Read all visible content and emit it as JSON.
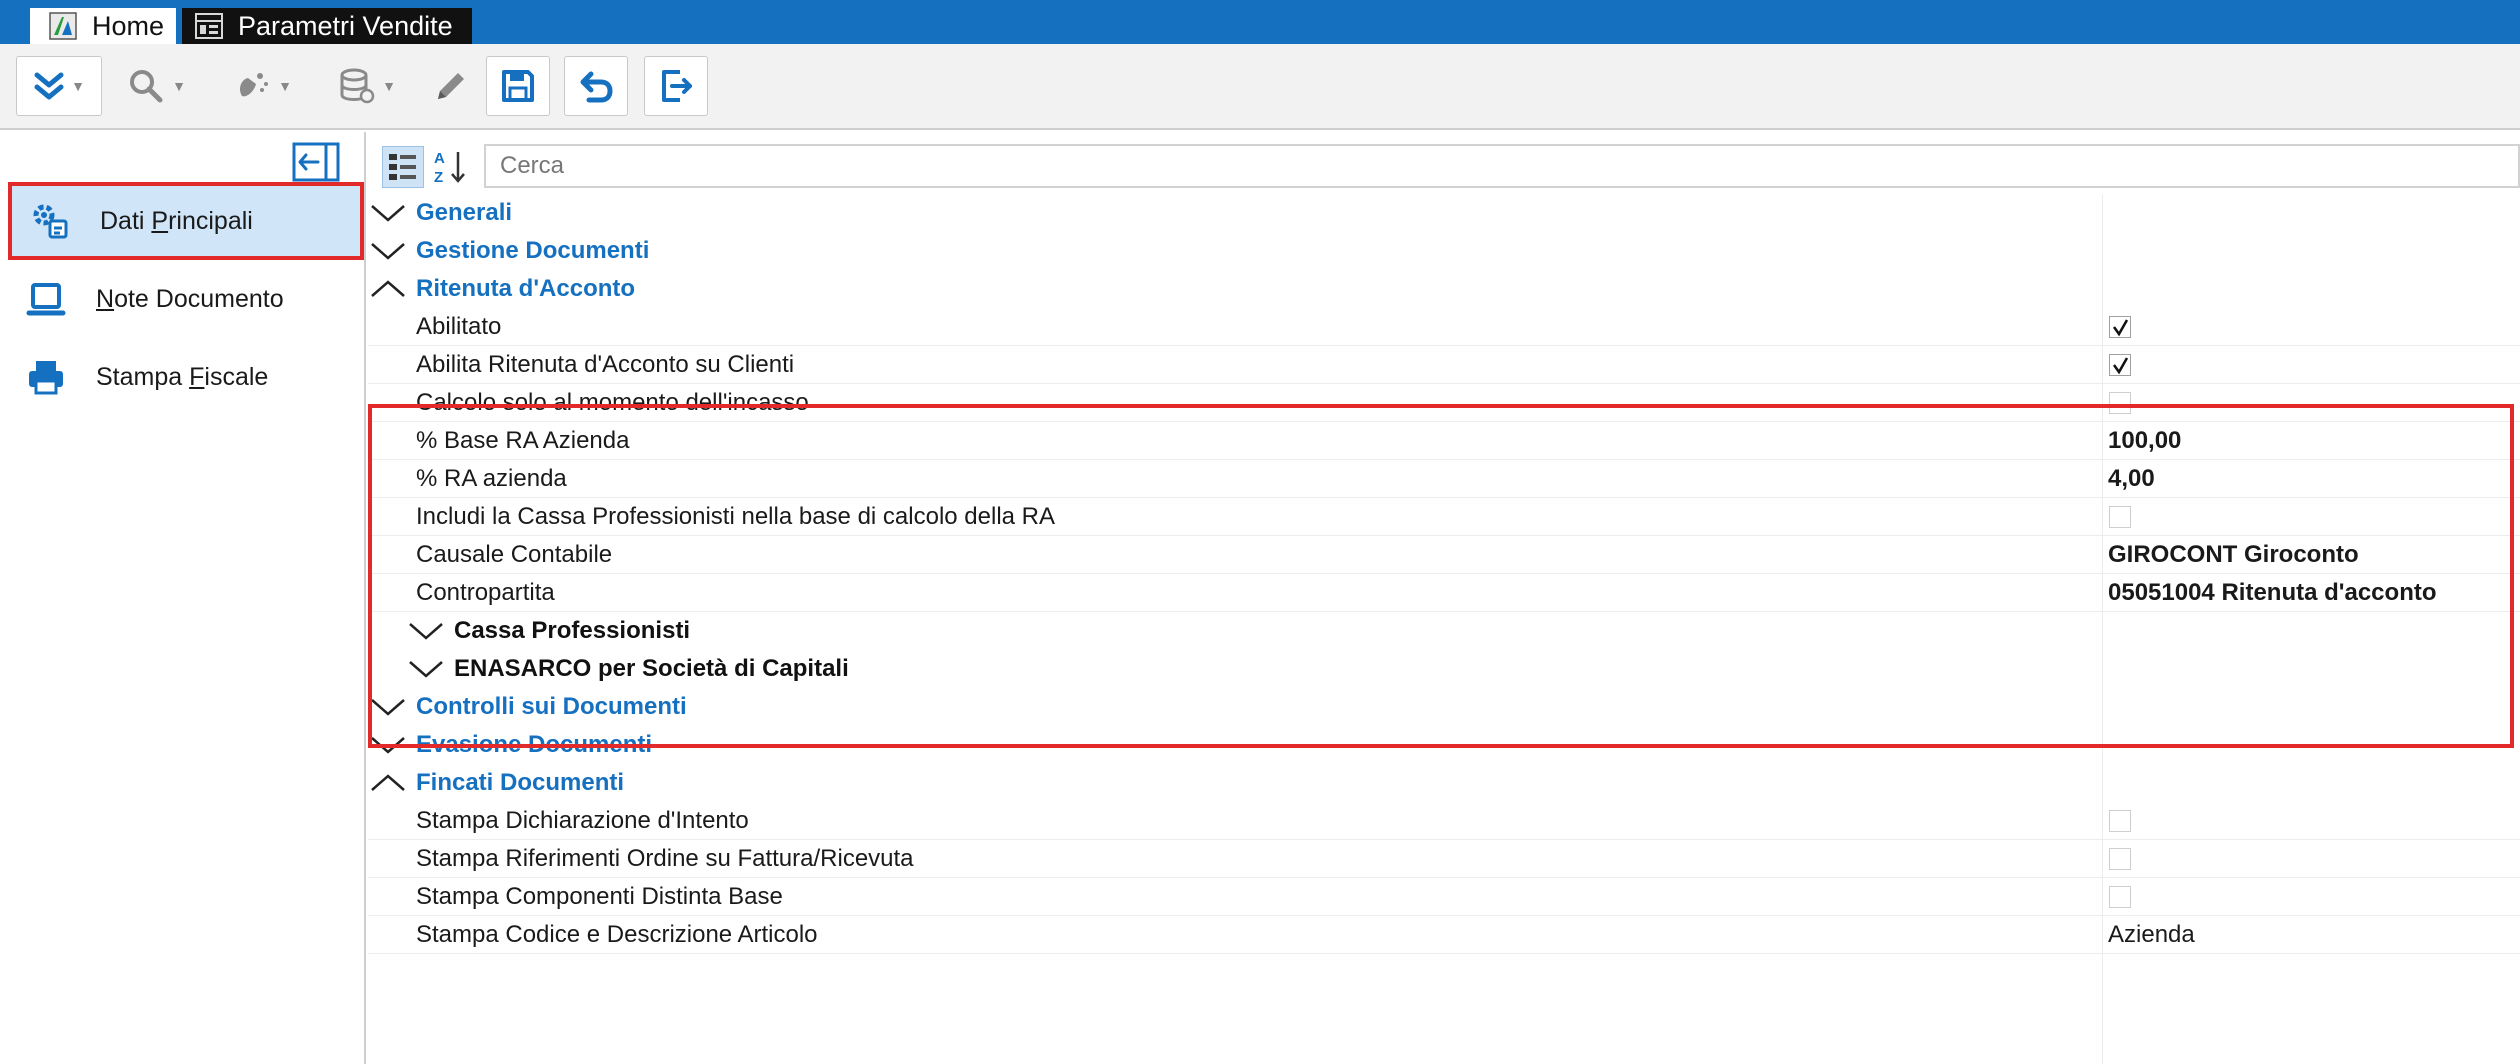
{
  "tabs": [
    {
      "label": "Home",
      "icon": "app-logo-icon"
    },
    {
      "label": "Parametri Vendite",
      "icon": "table-window-icon"
    }
  ],
  "toolbar": {
    "buttons": [
      {
        "name": "expand-menu-button",
        "icon": "double-chevron-down-icon"
      },
      {
        "name": "search-button",
        "icon": "magnifier-icon"
      },
      {
        "name": "wizard-button",
        "icon": "magic-wand-icon"
      },
      {
        "name": "database-button",
        "icon": "database-icon"
      },
      {
        "name": "edit-button",
        "icon": "pencil-icon"
      },
      {
        "name": "save-button",
        "icon": "floppy-disk-icon"
      },
      {
        "name": "undo-button",
        "icon": "undo-arrow-icon"
      },
      {
        "name": "exit-button",
        "icon": "exit-icon"
      }
    ],
    "accent_color": "#1570c0"
  },
  "sidebar": {
    "items": [
      {
        "label_pre": "Dati ",
        "label_ul": "P",
        "label_post": "rincipali",
        "icon": "settings-gear-icon",
        "selected": true
      },
      {
        "label_pre": "",
        "label_ul": "N",
        "label_post": "ote Documento",
        "icon": "laptop-icon",
        "selected": false
      },
      {
        "label_pre": "Stampa ",
        "label_ul": "F",
        "label_post": "iscale",
        "icon": "printer-icon",
        "selected": false
      }
    ]
  },
  "search": {
    "placeholder": "Cerca",
    "value": ""
  },
  "grid": {
    "categories": {
      "generali": {
        "label": "Generali",
        "expanded": false
      },
      "gestione_documenti": {
        "label": "Gestione Documenti",
        "expanded": false
      },
      "ritenuta": {
        "label": "Ritenuta d'Acconto",
        "expanded": true,
        "props": [
          {
            "label": "Abilitato",
            "type": "checkbox",
            "checked": true
          },
          {
            "label": "Abilita Ritenuta d'Acconto su Clienti",
            "type": "checkbox",
            "checked": true
          },
          {
            "label": "Calcolo solo al momento dell'incasso",
            "type": "checkbox",
            "checked": false
          },
          {
            "label": "% Base RA Azienda",
            "type": "text",
            "value": "100,00"
          },
          {
            "label": "% RA azienda",
            "type": "text",
            "value": "4,00"
          },
          {
            "label": "Includi la Cassa Professionisti nella base di calcolo della RA",
            "type": "checkbox",
            "checked": false
          },
          {
            "label": "Causale Contabile",
            "type": "text",
            "value": "GIROCONT Giroconto"
          },
          {
            "label": "Contropartita",
            "type": "text",
            "value": "05051004 Ritenuta d'acconto"
          }
        ]
      },
      "cassa_professionisti": {
        "label": "Cassa Professionisti",
        "expanded": false
      },
      "enasarco": {
        "label": "ENASARCO per Società di Capitali",
        "expanded": false
      },
      "controlli": {
        "label": "Controlli sui Documenti",
        "expanded": false
      },
      "evasione": {
        "label": "Evasione Documenti",
        "expanded": false
      },
      "fincati": {
        "label": "Fincati Documenti",
        "expanded": true,
        "props": [
          {
            "label": "Stampa Dichiarazione d'Intento",
            "type": "checkbox",
            "checked": false
          },
          {
            "label": "Stampa Riferimenti Ordine su Fattura/Ricevuta",
            "type": "checkbox",
            "checked": false
          },
          {
            "label": "Stampa Componenti Distinta Base",
            "type": "checkbox",
            "checked": false
          },
          {
            "label": "Stampa Codice e Descrizione Articolo",
            "type": "text",
            "value": "Azienda"
          }
        ]
      }
    }
  },
  "colors": {
    "category": "#1570c0",
    "selection": "#d0e5f7",
    "highlight": "#e22a2a"
  }
}
